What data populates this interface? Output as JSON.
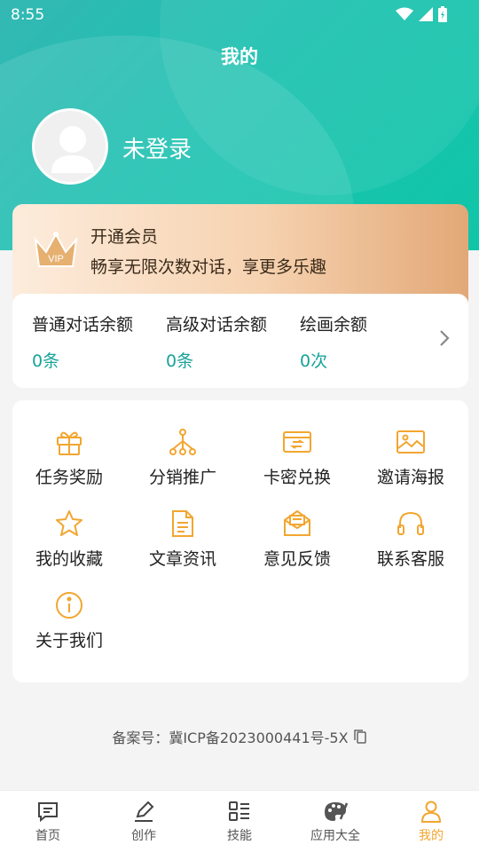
{
  "status_bar": {
    "time": "8:55"
  },
  "header": {
    "title": "我的"
  },
  "profile": {
    "name": "未登录"
  },
  "vip": {
    "title": "开通会员",
    "subtitle": "畅享无限次数对话，享更多乐趣"
  },
  "quota": [
    {
      "label": "普通对话余额",
      "value": "0条"
    },
    {
      "label": "高级对话余额",
      "value": "0条"
    },
    {
      "label": "绘画余额",
      "value": "0次"
    }
  ],
  "menu": [
    {
      "label": "任务奖励",
      "icon": "gift-icon"
    },
    {
      "label": "分销推广",
      "icon": "network-icon"
    },
    {
      "label": "卡密兑换",
      "icon": "card-exchange-icon"
    },
    {
      "label": "邀请海报",
      "icon": "image-icon"
    },
    {
      "label": "我的收藏",
      "icon": "star-icon"
    },
    {
      "label": "文章资讯",
      "icon": "document-icon"
    },
    {
      "label": "意见反馈",
      "icon": "mail-icon"
    },
    {
      "label": "联系客服",
      "icon": "headset-icon"
    },
    {
      "label": "关于我们",
      "icon": "info-icon"
    }
  ],
  "footer": {
    "icp": "备案号：冀ICP备2023000441号-5X"
  },
  "tabbar": [
    {
      "label": "首页",
      "icon": "chat-icon"
    },
    {
      "label": "创作",
      "icon": "pencil-icon"
    },
    {
      "label": "技能",
      "icon": "skills-icon"
    },
    {
      "label": "应用大全",
      "icon": "palette-icon"
    },
    {
      "label": "我的",
      "icon": "person-icon",
      "active": true
    }
  ],
  "colors": {
    "accent": "#f2a630",
    "teal": "#18a39a",
    "hero": "#1cc1b0"
  }
}
